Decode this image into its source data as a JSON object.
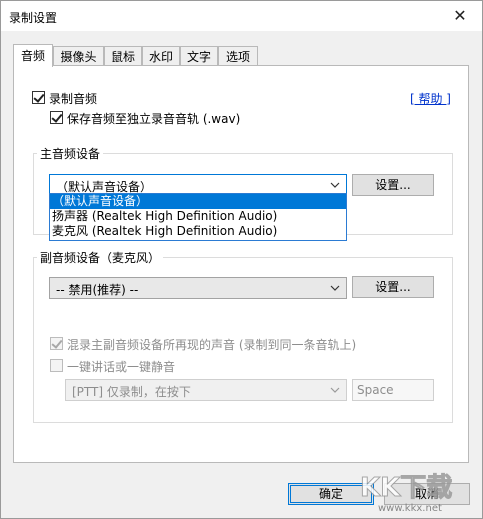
{
  "window": {
    "title": "录制设置",
    "close_glyph": "✕"
  },
  "tabs": [
    "音频",
    "摄像头",
    "鼠标",
    "水印",
    "文字",
    "选项"
  ],
  "audio": {
    "record_audio_label": "录制音频",
    "help_link": "[ 帮助 ]",
    "save_separate_label": "保存音频至独立录音音轨 (.wav)",
    "main_device": {
      "group_title": "主音频设备",
      "selected": "（默认声音设备）",
      "settings_button": "设置...",
      "options": [
        "（默认声音设备）",
        "扬声器 (Realtek High Definition Audio)",
        "麦克风 (Realtek High Definition Audio)"
      ]
    },
    "secondary_device": {
      "group_title": "副音频设备（麦克风）",
      "selected": "-- 禁用(推荐) --",
      "settings_button": "设置..."
    },
    "mix_label": "混录主副音频设备所再现的声音 (录制到同一条音轨上)",
    "ptt_label": "一键讲话或一键静音",
    "ptt_mode": "[PTT] 仅录制，在按下",
    "ptt_key": "Space"
  },
  "footer": {
    "ok": "确定",
    "cancel": "取消"
  },
  "watermark": {
    "brand": "KK下载",
    "url": "www.kkx.net"
  },
  "colors": {
    "accent": "#0078d7",
    "link": "#0033cc"
  }
}
